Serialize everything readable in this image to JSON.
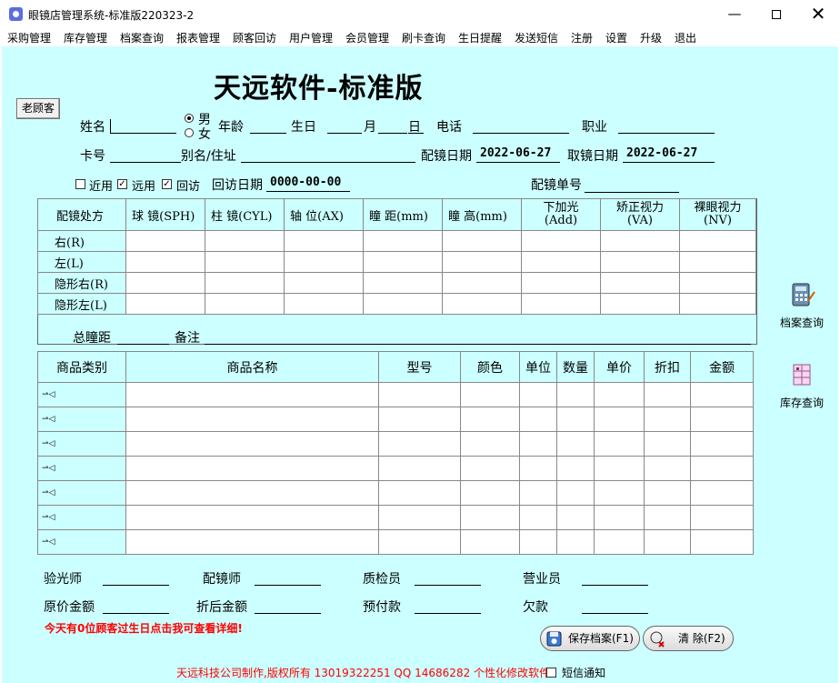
{
  "window": {
    "title": "眼镜店管理系统-标准版220323-2",
    "min_glyph": "—",
    "close_glyph": "✕"
  },
  "menu": [
    "采购管理",
    "库存管理",
    "档案查询",
    "报表管理",
    "顾客回访",
    "用户管理",
    "会员管理",
    "刷卡查询",
    "生日提醒",
    "发送短信",
    "注册",
    "设置",
    "升级",
    "退出"
  ],
  "header": {
    "heading": "天远软件-标准版",
    "old_customer_button": "老顾客"
  },
  "customer": {
    "name_label": "姓名",
    "gender_male": "男",
    "gender_female": "女",
    "gender_selected": "男",
    "age_label": "年龄",
    "birthday_label": "生日",
    "month_label": "月",
    "day_label": "日",
    "phone_label": "电话",
    "job_label": "职业",
    "card_label": "卡号",
    "alias_label": "别名/住址",
    "fit_date_label": "配镜日期",
    "fit_date": "2022-06-27",
    "pickup_date_label": "取镜日期",
    "pickup_date": "2022-06-27",
    "near_label": "近用",
    "near_checked": false,
    "far_label": "远用",
    "far_checked": true,
    "revisit_label": "回访",
    "revisit_checked": true,
    "revisit_date_label": "回访日期",
    "revisit_date": "0000-00-00",
    "order_no_label": "配镜单号",
    "check_glyph": "✓"
  },
  "rx": {
    "headers": [
      "配镜处方",
      "球 镜(SPH)",
      "柱 镜(CYL)",
      "轴 位(AX)",
      "瞳 距(mm)",
      "瞳 高(mm)",
      "下加光\n(Add)",
      "矫正视力\n(VA)",
      "裸眼视力\n(NV)"
    ],
    "rows": [
      "右(R)",
      "左(L)",
      "隐形右(R)",
      "隐形左(L)"
    ],
    "total_pd_label": "总瞳距",
    "remark_label": "备注"
  },
  "goods": {
    "headers": [
      "商品类别",
      "商品名称",
      "型号",
      "颜色",
      "单位",
      "数量",
      "单价",
      "折扣",
      "金额"
    ],
    "row_count": 7,
    "row_marker": "⇀◁"
  },
  "staff": {
    "optometrist": "验光师",
    "fitter": "配镜师",
    "inspector": "质检员",
    "sales": "营业员",
    "original_amount": "原价金额",
    "discount_amount": "折后金额",
    "prepaid": "预付款",
    "owed": "欠款"
  },
  "notice": "今天有0位顾客过生日点击我可查看详细!",
  "buttons": {
    "save": "保存档案(F1)",
    "clear": "清  除(F2)"
  },
  "side": {
    "archive": "档案查询",
    "stock": "库存查询"
  },
  "footer": {
    "copyright": "天远科技公司制作,版权所有 13019322251  QQ 14686282 个性化修改软件",
    "sms_label": "短信通知",
    "sms_checked": false
  },
  "colors": {
    "background": "#ccffff",
    "notice": "#ff0000"
  }
}
